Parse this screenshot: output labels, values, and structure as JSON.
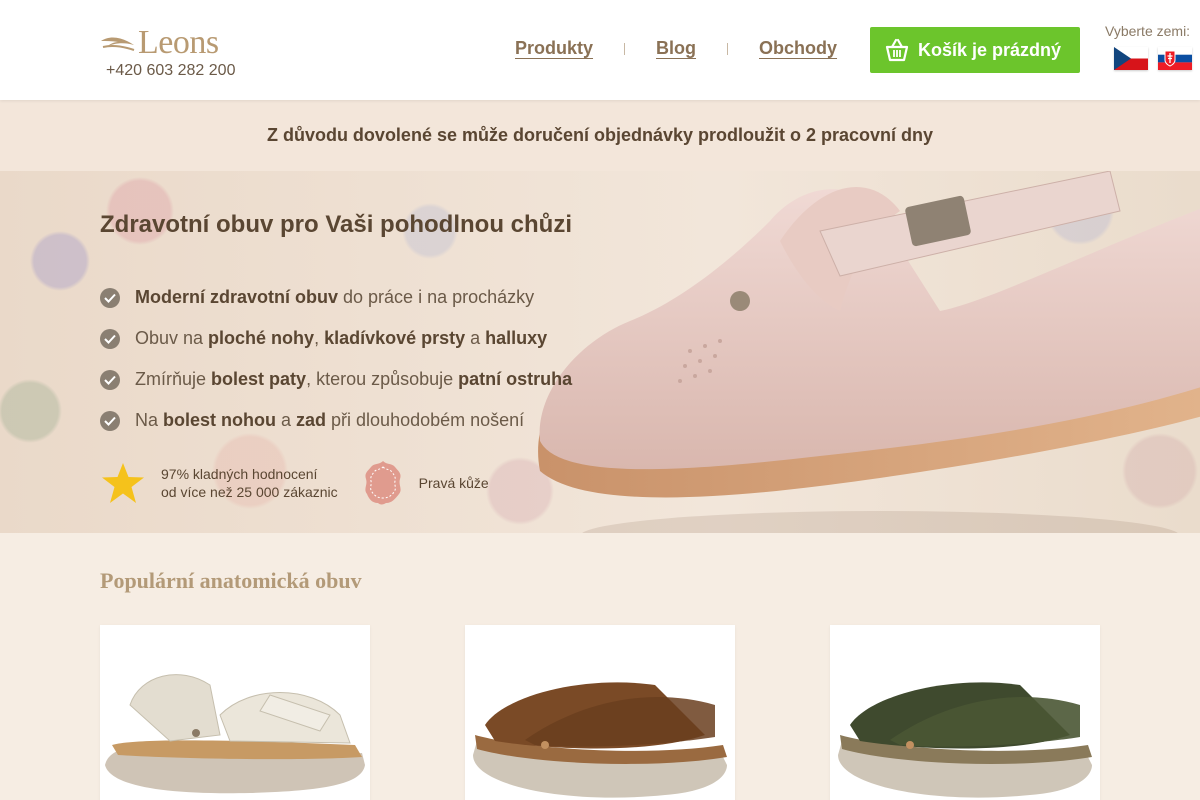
{
  "header": {
    "logo_text": "Leons",
    "phone": "+420 603 282 200",
    "nav": [
      "Produkty",
      "Blog",
      "Obchody"
    ],
    "cart_label": "Košík je prázdný",
    "country_label": "Vyberte zemi:",
    "flags": [
      "cz-flag-icon",
      "sk-flag-icon"
    ]
  },
  "notice": "Z důvodu dovolené se může doručení objednávky prodloužit o 2 pracovní dny",
  "hero": {
    "title": "Zdravotní obuv pro Vaši pohodlnou chůzi",
    "features": [
      {
        "b1": "Moderní zdravotní obuv",
        "t1": " do práce i na procházky"
      },
      {
        "t0": "Obuv na ",
        "b1": "ploché nohy",
        "t1": ", ",
        "b2": "kladívkové prsty",
        "t2": " a ",
        "b3": "halluxy"
      },
      {
        "t0": "Zmírňuje ",
        "b1": "bolest paty",
        "t1": ", kterou způsobuje ",
        "b2": "patní ostruha"
      },
      {
        "t0": "Na ",
        "b1": "bolest nohou",
        "t1": " a ",
        "b2": "zad",
        "t2": " při dlouhodobém nošení"
      }
    ],
    "badge_rating_line1": "97% kladných hodnocení",
    "badge_rating_line2": "od více než 25 000 zákaznic",
    "badge_leather": "Pravá kůže"
  },
  "popular": {
    "title": "Populární anatomická obuv",
    "products": [
      {
        "icon": "beige-sandal-image"
      },
      {
        "icon": "brown-slide-image"
      },
      {
        "icon": "green-slide-image"
      }
    ]
  },
  "colors": {
    "accent_green": "#6cc52c",
    "brand_tan": "#b89a72",
    "text_brown": "#5a4632"
  }
}
